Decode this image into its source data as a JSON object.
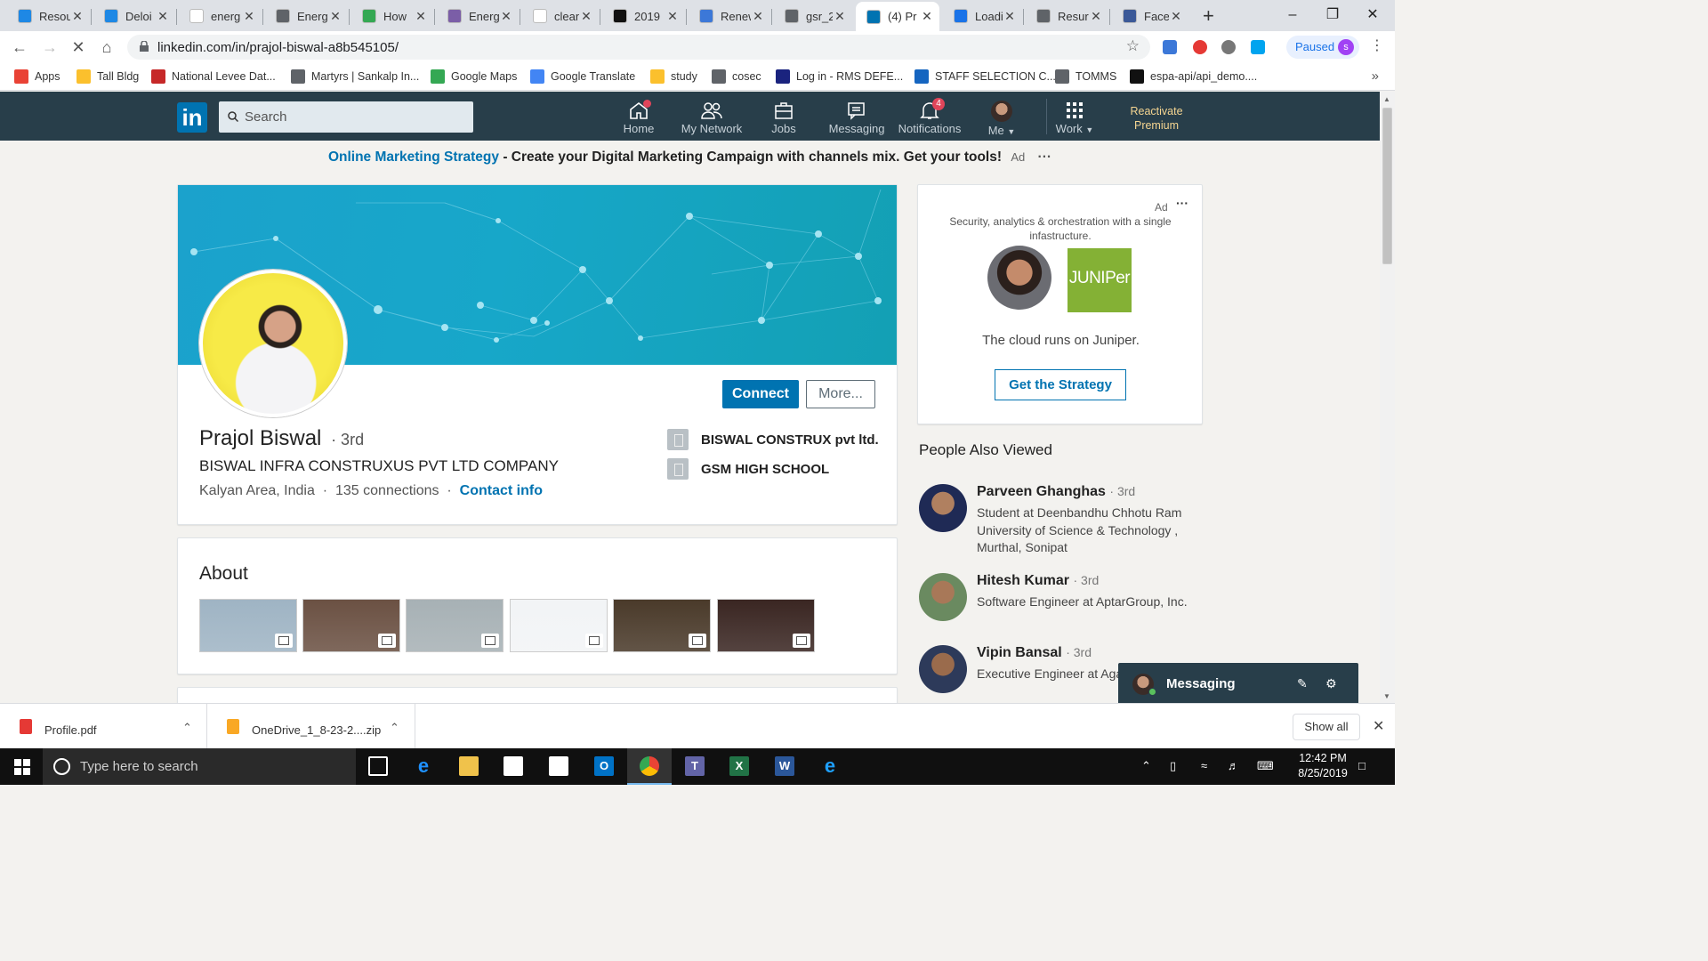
{
  "browser": {
    "tabs": [
      {
        "title": "Resou",
        "color": "#1e88e5"
      },
      {
        "title": "Deloi",
        "color": "#1e88e5"
      },
      {
        "title": "energ",
        "color": "#ffffff"
      },
      {
        "title": "Energ",
        "color": "#5f6368"
      },
      {
        "title": "How",
        "color": "#34a853"
      },
      {
        "title": "Energ",
        "color": "#7b5ea7"
      },
      {
        "title": "clean",
        "color": "#ffffff"
      },
      {
        "title": "2019",
        "color": "#111111"
      },
      {
        "title": "Renew",
        "color": "#3c78d8"
      },
      {
        "title": "gsr_2",
        "color": "#5f6368"
      },
      {
        "title": "(4) Pr",
        "color": "#0073b1"
      },
      {
        "title": "Loadi",
        "color": "#1a73e8"
      },
      {
        "title": "Resur",
        "color": "#5f6368"
      },
      {
        "title": "Faceb",
        "color": "#3b5998"
      }
    ],
    "url": "linkedin.com/in/prajol-biswal-a8b545105/",
    "profile_status": "Paused",
    "profile_initial": "s",
    "bookmarks": [
      {
        "label": "Apps",
        "color": "#e94235"
      },
      {
        "label": "Tall Bldg",
        "color": "#fbc02d"
      },
      {
        "label": "National Levee Dat...",
        "color": "#c62828"
      },
      {
        "label": "Martyrs | Sankalp In...",
        "color": "#5f6368"
      },
      {
        "label": "Google Maps",
        "color": "#34a853"
      },
      {
        "label": "Google Translate",
        "color": "#4285f4"
      },
      {
        "label": "study",
        "color": "#fbc02d"
      },
      {
        "label": "cosec",
        "color": "#5f6368"
      },
      {
        "label": "Log in - RMS DEFE...",
        "color": "#1a237e"
      },
      {
        "label": "STAFF SELECTION C...",
        "color": "#1565c0"
      },
      {
        "label": "TOMMS",
        "color": "#5f6368"
      },
      {
        "label": "espa-api/api_demo....",
        "color": "#111111"
      }
    ],
    "bookmarks_more": "»"
  },
  "linkedin": {
    "logo": "in",
    "search_placeholder": "Search",
    "nav": {
      "home": "Home",
      "network": "My Network",
      "jobs": "Jobs",
      "messaging": "Messaging",
      "notifications": "Notifications",
      "notifications_count": "4",
      "me": "Me",
      "work": "Work",
      "premium": "Reactivate Premium"
    },
    "ad_banner": {
      "link": "Online Marketing Strategy",
      "text": " - Create your Digital Marketing Campaign with channels mix. Get your tools!",
      "ad_label": "Ad",
      "menu": "···"
    },
    "profile": {
      "name": "Prajol Biswal",
      "degree": "· 3rd",
      "headline": "BISWAL INFRA CONSTRUXUS PVT LTD COMPANY",
      "location": "Kalyan Area, India",
      "connections": "135 connections",
      "contact_info": "Contact info",
      "connect_button": "Connect",
      "more_button": "More...",
      "company": "BISWAL CONSTRUX pvt ltd.",
      "school": "GSM HIGH SCHOOL"
    },
    "about": {
      "title": "About",
      "media": [
        {
          "name": "tower-photo",
          "color": "#9fb4c4"
        },
        {
          "name": "building-render-1",
          "color": "#6b5143"
        },
        {
          "name": "hotel-photo",
          "color": "#a7b1b5"
        },
        {
          "name": "blank-image",
          "color": "#f2f4f6"
        },
        {
          "name": "night-building-1",
          "color": "#4a3a2a"
        },
        {
          "name": "night-building-2",
          "color": "#3a2622"
        }
      ]
    },
    "right_ad": {
      "label": "Ad",
      "menu": "···",
      "description": "Security, analytics & orchestration with a single infastructure.",
      "brand_logo": "JUNIPer",
      "tagline": "The cloud runs on Juniper.",
      "cta": "Get the Strategy"
    },
    "people_also_viewed": {
      "title": "People Also Viewed",
      "people": [
        {
          "name": "Parveen Ghanghas",
          "degree": "· 3rd",
          "desc": "Student at Deenbandhu Chhotu Ram University of Science & Technology , Murthal, Sonipat"
        },
        {
          "name": "Hitesh Kumar",
          "degree": "· 3rd",
          "desc": "Software Engineer at AptarGroup, Inc."
        },
        {
          "name": "Vipin Bansal",
          "degree": "· 3rd",
          "desc": "Executive Engineer at Aga Bhiwani"
        }
      ]
    },
    "messaging_label": "Messaging"
  },
  "downloads": {
    "items": [
      {
        "name": "Profile.pdf",
        "color": "#e53935"
      },
      {
        "name": "OneDrive_1_8-23-2....zip",
        "color": "#f9a825"
      }
    ],
    "show_all": "Show all"
  },
  "taskbar": {
    "search_placeholder": "Type here to search",
    "time": "12:42 PM",
    "date": "8/25/2019"
  }
}
